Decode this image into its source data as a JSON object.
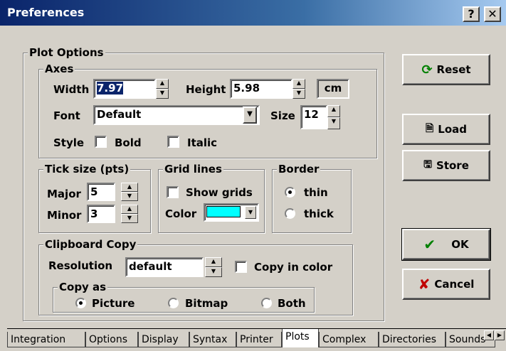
{
  "window": {
    "title": "Preferences",
    "help_label": "?",
    "close_label": "✕"
  },
  "plot_options": {
    "title": "Plot Options",
    "axes": {
      "title": "Axes",
      "width_label": "Width",
      "width_value": "7.97",
      "height_label": "Height",
      "height_value": "5.98",
      "unit": "cm",
      "font_label": "Font",
      "font_value": "Default",
      "size_label": "Size",
      "size_value": "12",
      "style_label": "Style",
      "bold_label": "Bold",
      "italic_label": "Italic"
    },
    "tick": {
      "title": "Tick size (pts)",
      "major_label": "Major",
      "major_value": "5",
      "minor_label": "Minor",
      "minor_value": "3"
    },
    "grid": {
      "title": "Grid lines",
      "show_label": "Show grids",
      "color_label": "Color",
      "color_value": "#00ffff"
    },
    "border": {
      "title": "Border",
      "thin_label": "thin",
      "thick_label": "thick",
      "selected": "thin"
    },
    "clipboard": {
      "title": "Clipboard Copy",
      "resolution_label": "Resolution",
      "resolution_value": "default",
      "copy_in_color_label": "Copy in color",
      "copy_as_title": "Copy as",
      "picture_label": "Picture",
      "bitmap_label": "Bitmap",
      "both_label": "Both",
      "selected": "Picture"
    }
  },
  "buttons": {
    "reset": "Reset",
    "load": "Load",
    "store": "Store",
    "ok": "OK",
    "cancel": "Cancel"
  },
  "tabs": [
    "Integration",
    "Options",
    "Display",
    "Syntax",
    "Printer",
    "Plots",
    "Complex",
    "Directories",
    "Sounds"
  ],
  "active_tab": "Plots",
  "colors": {
    "title_bar": "#0a246a",
    "grid_color": "#00ffff",
    "ok_check": "#008000",
    "cancel_x": "#c00000",
    "reset_icon": "#008000"
  }
}
